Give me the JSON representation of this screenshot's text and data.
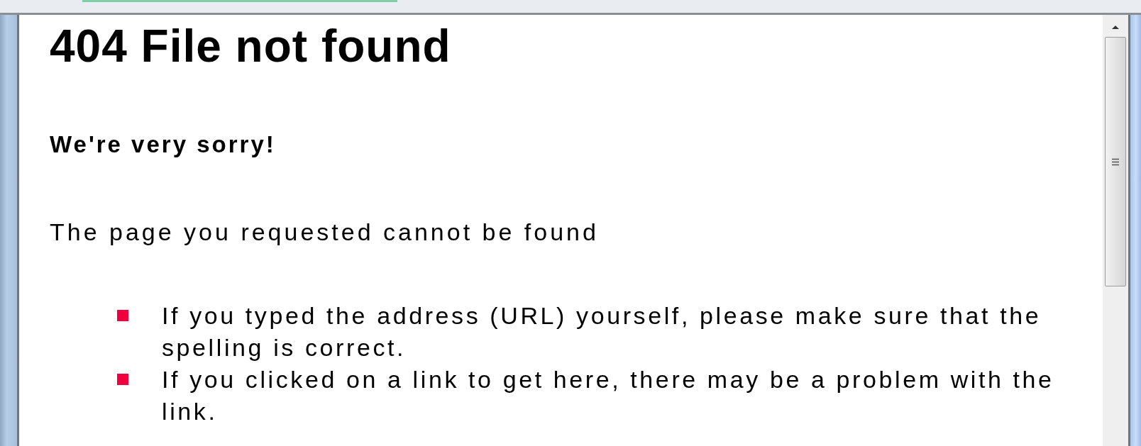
{
  "page": {
    "heading": "404 File not found",
    "apology": "We're very sorry!",
    "message": "The page you requested cannot be found",
    "tips": [
      "If you typed the address (URL) yourself, please make sure that the spelling is correct.",
      "If you clicked on a link to get here, there may be a problem with the link."
    ]
  }
}
